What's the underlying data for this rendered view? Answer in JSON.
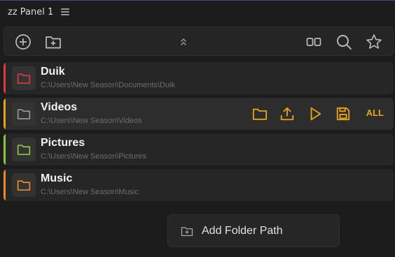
{
  "panel": {
    "title": "zz Panel 1"
  },
  "toolbar": {
    "icons": [
      "add-circle-icon",
      "add-folder-icon",
      "collapse-chevrons-icon",
      "columns-icon",
      "search-icon",
      "star-icon"
    ]
  },
  "folders": [
    {
      "name": "Duik",
      "path": "C:\\Users\\New Season\\Documents\\Duik",
      "color": "#e0393e",
      "active": false
    },
    {
      "name": "Videos",
      "path": "C:\\Users\\New Season\\Videos",
      "color": "#9a9a9a",
      "stripe": "#e6a417",
      "active": true
    },
    {
      "name": "Pictures",
      "path": "C:\\Users\\New Season\\Pictures",
      "color": "#8dc63f",
      "active": false
    },
    {
      "name": "Music",
      "path": "C:\\Users\\New Season\\Music",
      "color": "#f08a24",
      "active": false
    }
  ],
  "row_actions": {
    "all_label": "ALL",
    "accent": "#e6a417",
    "icons": [
      "open-folder-icon",
      "upload-icon",
      "play-icon",
      "save-icon"
    ]
  },
  "add_folder": {
    "label": "Add Folder Path"
  }
}
